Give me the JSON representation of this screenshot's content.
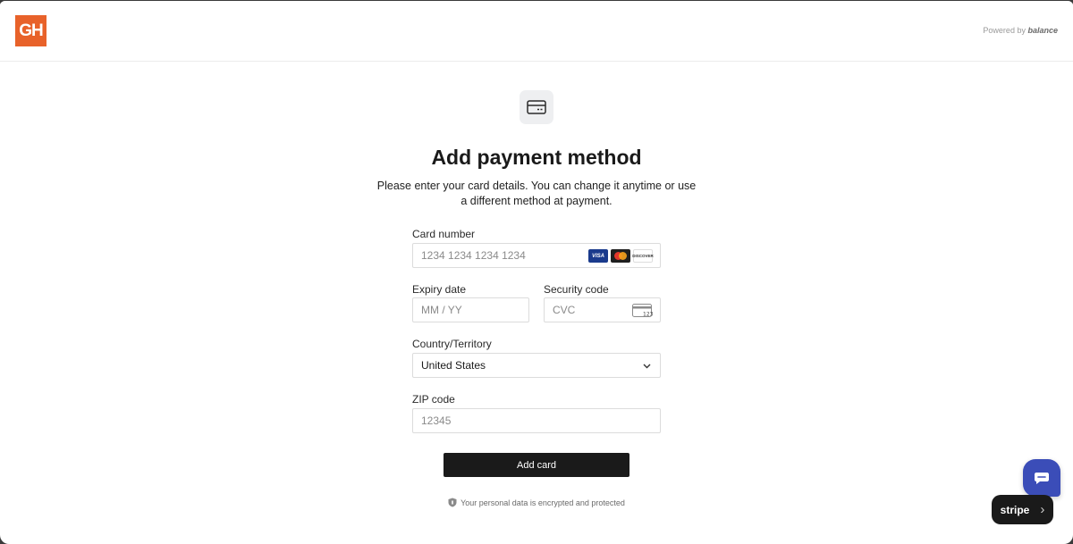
{
  "header": {
    "logo_text": "GH",
    "powered_prefix": "Powered by",
    "powered_brand": "balance"
  },
  "main": {
    "title": "Add payment method",
    "subtitle": "Please enter your card details. You can change it anytime or use a different method at payment."
  },
  "form": {
    "card_number": {
      "label": "Card number",
      "placeholder": "1234 1234 1234 1234",
      "value": ""
    },
    "card_brands": [
      "VISA",
      "mastercard",
      "DISCOVER"
    ],
    "expiry": {
      "label": "Expiry date",
      "placeholder": "MM / YY",
      "value": ""
    },
    "security": {
      "label": "Security code",
      "placeholder": "CVC",
      "value": "",
      "icon_text": "123"
    },
    "country": {
      "label": "Country/Territory",
      "selected": "United States"
    },
    "zip": {
      "label": "ZIP code",
      "placeholder": "12345",
      "value": ""
    },
    "submit_label": "Add card",
    "secure_note": "Your personal data is encrypted and protected"
  },
  "widgets": {
    "stripe_label": "stripe",
    "stripe_chevron": "›"
  },
  "colors": {
    "brand_orange": "#e8622a",
    "button_bg": "#1a1a1a",
    "chat_blue": "#3b4db8"
  }
}
